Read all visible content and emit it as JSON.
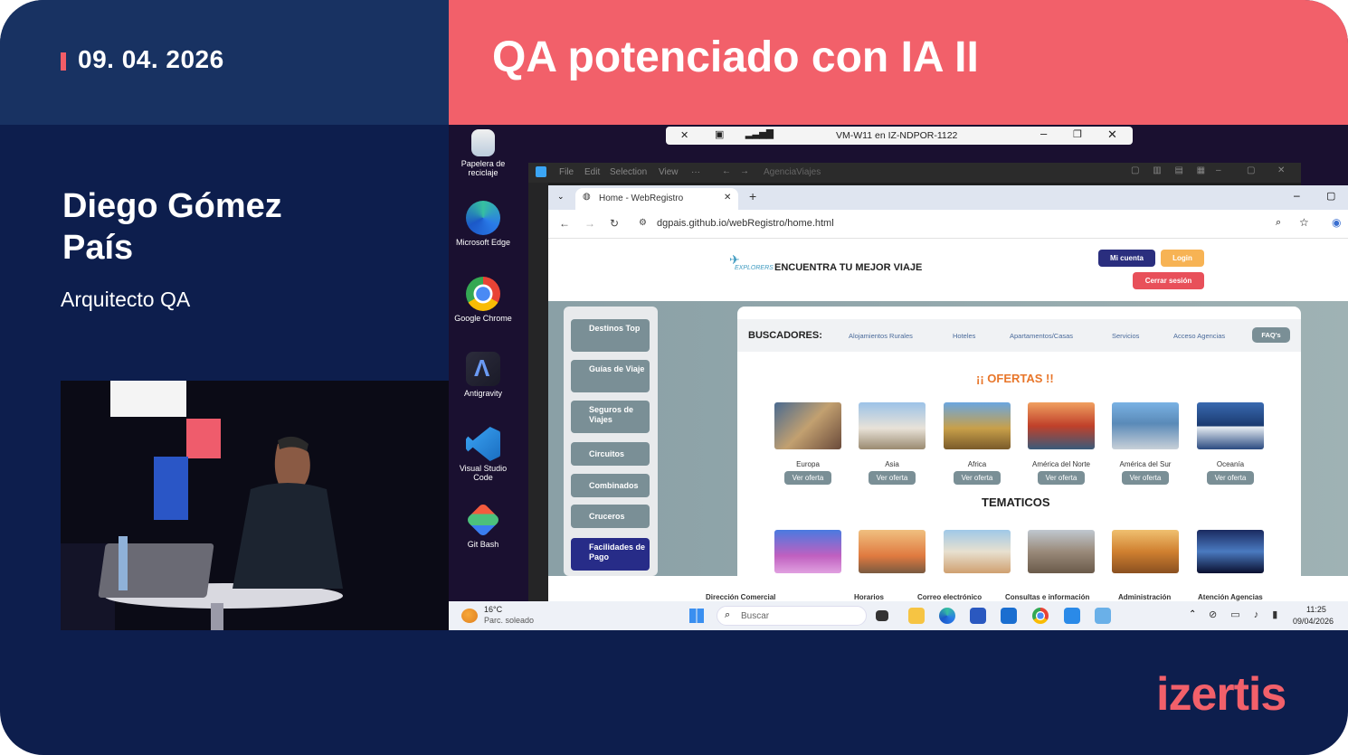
{
  "slide": {
    "date": "09. 04. 2026",
    "title": "QA potenciado con IA II",
    "speaker_name": "Diego Gómez País",
    "speaker_role": "Arquitecto QA",
    "brand": "izertis",
    "colors": {
      "navy": "#0d1e4d",
      "coral": "#f2606a",
      "header_left": "#183262"
    }
  },
  "vm_bar": {
    "title": "VM-W11 en IZ-NDPOR-1122",
    "icons": [
      "pin-off-icon",
      "lock-icon",
      "signal-icon",
      "minimize-icon",
      "restore-icon",
      "close-icon"
    ]
  },
  "desktop_icons": [
    {
      "label": "Papelera de reciclaje",
      "icon": "recycle-bin-icon"
    },
    {
      "label": "Microsoft Edge",
      "icon": "edge-icon"
    },
    {
      "label": "Google Chrome",
      "icon": "chrome-icon"
    },
    {
      "label": "Antigravity",
      "icon": "antigravity-icon"
    },
    {
      "label": "Visual Studio Code",
      "icon": "vscode-icon"
    },
    {
      "label": "Git Bash",
      "icon": "git-bash-icon"
    }
  ],
  "vscode": {
    "menu": [
      "File",
      "Edit",
      "Selection",
      "View",
      "···"
    ],
    "search": "AgenciaViajes"
  },
  "browser": {
    "tab_title": "Home - WebRegistro",
    "url": "dgpais.github.io/webRegistro/home.html"
  },
  "site": {
    "logo_text": "EXPLORERS",
    "tagline": "ENCUENTRA TU MEJOR VIAJE",
    "buttons": {
      "account": "Mi cuenta",
      "login": "Login",
      "logout": "Cerrar sesión"
    },
    "sidenav": [
      "Destinos Top",
      "Guías de Viaje",
      "Seguros de Viajes",
      "Circuitos",
      "Combinados",
      "Cruceros",
      "Facilidades de Pago"
    ],
    "search_label": "BUSCADORES:",
    "search_links": [
      "Alojamientos Rurales",
      "Hoteles",
      "Apartamentos/Casas",
      "Servicios",
      "Acceso Agencias",
      "FAQ's"
    ],
    "offers_title": "¡¡ OFERTAS !!",
    "offer_button": "Ver oferta",
    "regions": [
      "Europa",
      "Asia",
      "Africa",
      "América del Norte",
      "América del Sur",
      "Oceanía"
    ],
    "tematicos_title": "TEMATICOS",
    "footer": [
      "Dirección Comercial",
      "Horarios",
      "Correo electrónico",
      "Consultas e información",
      "Administración",
      "Atención Agencias"
    ]
  },
  "taskbar": {
    "weather_temp": "16°C",
    "weather_desc": "Parc. soleado",
    "search_placeholder": "Buscar",
    "time": "11:25",
    "date": "09/04/2026"
  }
}
